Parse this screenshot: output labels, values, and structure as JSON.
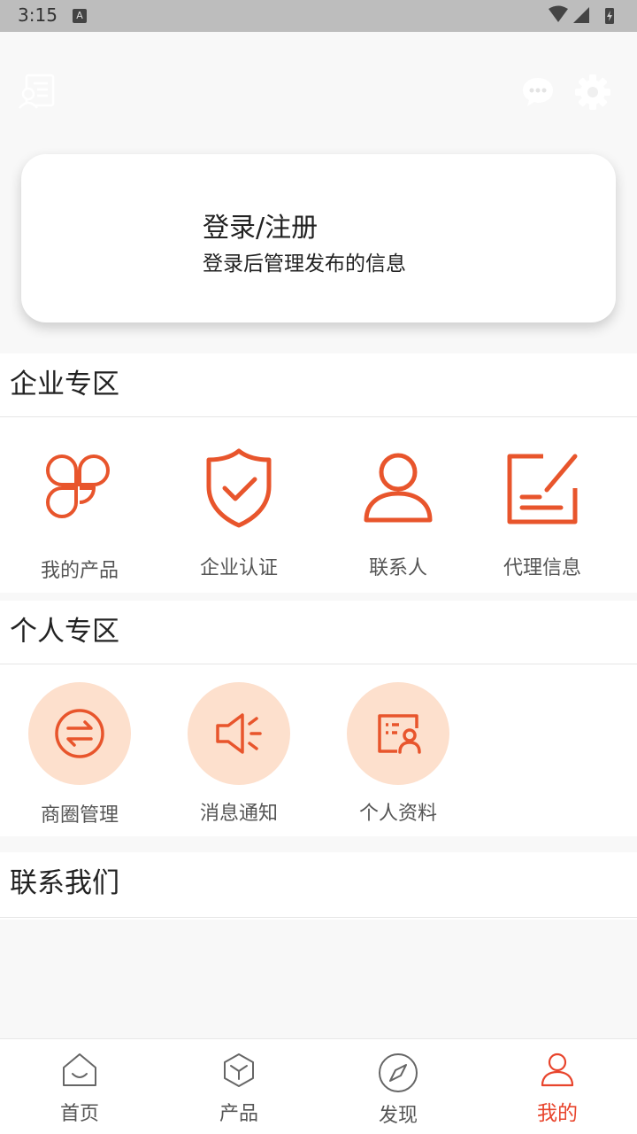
{
  "status": {
    "time": "3:15",
    "a_badge": "A"
  },
  "header": {
    "left_icon": "contact-card-icon",
    "chat_icon": "chat-bubble-icon",
    "settings_icon": "gear-icon"
  },
  "login": {
    "title": "登录/注册",
    "subtitle": "登录后管理发布的信息"
  },
  "enterprise": {
    "title": "企业专区",
    "items": [
      {
        "label": "我的产品",
        "icon": "clover-icon"
      },
      {
        "label": "企业认证",
        "icon": "shield-check-icon"
      },
      {
        "label": "联系人",
        "icon": "person-icon"
      },
      {
        "label": "代理信息",
        "icon": "edit-document-icon"
      }
    ]
  },
  "personal": {
    "title": "个人专区",
    "items": [
      {
        "label": "商圈管理",
        "icon": "exchange-icon"
      },
      {
        "label": "消息通知",
        "icon": "speaker-icon"
      },
      {
        "label": "个人资料",
        "icon": "profile-card-icon"
      }
    ]
  },
  "contact": {
    "title": "联系我们"
  },
  "tabs": [
    {
      "label": "首页",
      "icon": "home-icon",
      "active": false
    },
    {
      "label": "产品",
      "icon": "cube-icon",
      "active": false
    },
    {
      "label": "发现",
      "icon": "compass-icon",
      "active": false
    },
    {
      "label": "我的",
      "icon": "user-icon",
      "active": true
    }
  ],
  "colors": {
    "accent": "#e8552c",
    "tab_active": "#e8442c",
    "circle_bg": "#fde0cd"
  }
}
